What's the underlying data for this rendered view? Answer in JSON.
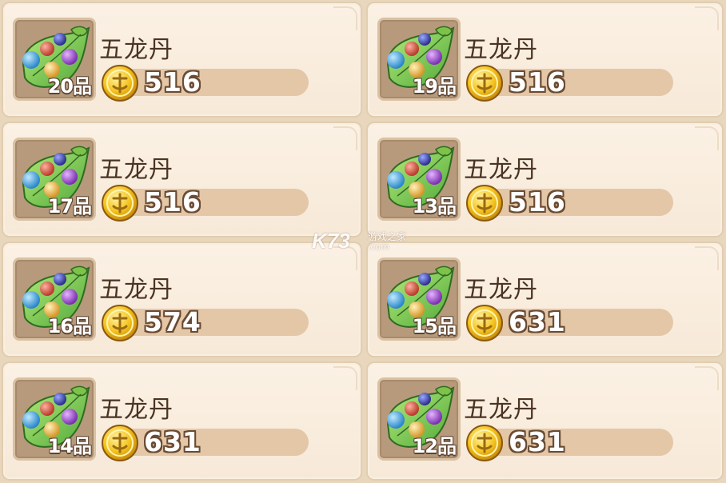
{
  "items": [
    {
      "name": "五龙丹",
      "grade": "20品",
      "price": "516"
    },
    {
      "name": "五龙丹",
      "grade": "19品",
      "price": "516"
    },
    {
      "name": "五龙丹",
      "grade": "17品",
      "price": "516"
    },
    {
      "name": "五龙丹",
      "grade": "13品",
      "price": "516"
    },
    {
      "name": "五龙丹",
      "grade": "16品",
      "price": "574"
    },
    {
      "name": "五龙丹",
      "grade": "15品",
      "price": "631"
    },
    {
      "name": "五龙丹",
      "grade": "14品",
      "price": "631"
    },
    {
      "name": "五龙丹",
      "grade": "12品",
      "price": "631"
    }
  ],
  "currency_icon": "gold-coin-icon",
  "item_icon": "five-dragon-pill-icon",
  "watermark": {
    "logo": "K73",
    "site_name": "游戏之家",
    "url": ".com"
  },
  "colors": {
    "card_bg": "#fbf1e4",
    "price_bar": "#e3c7a7",
    "text_dark": "#4a3424",
    "coin": "#f2b51c"
  }
}
